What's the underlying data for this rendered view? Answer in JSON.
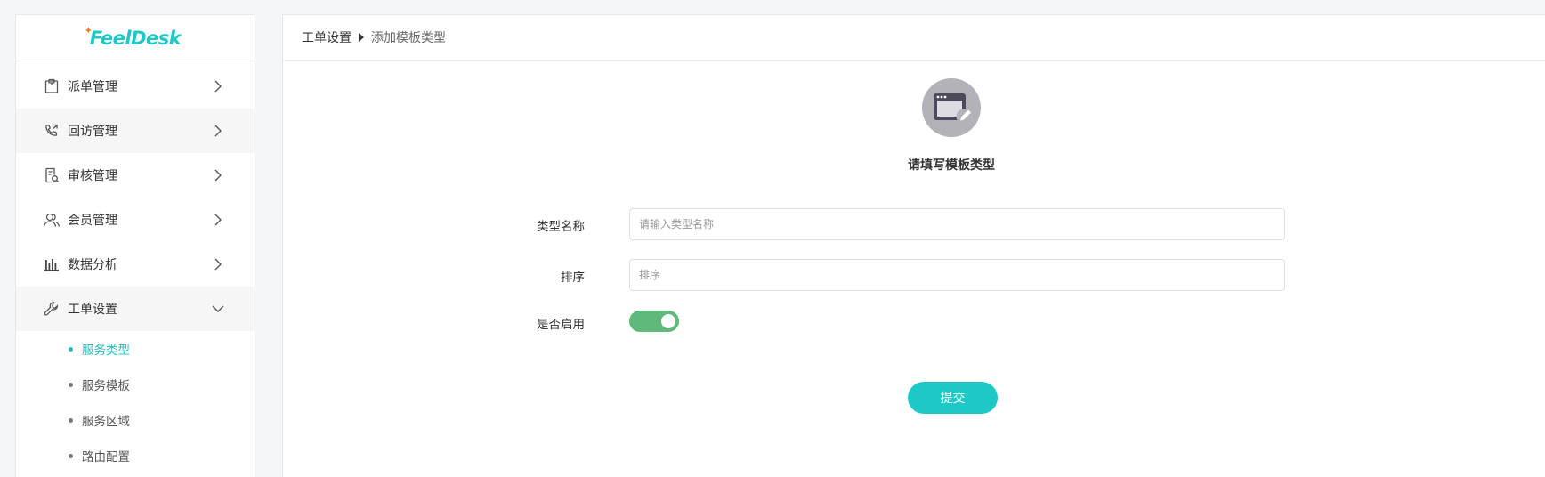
{
  "logo": {
    "text": "FeelDesk",
    "brand_color": "#1fc8c4",
    "accent_color": "#f07a2a"
  },
  "sidebar": {
    "items": [
      {
        "label": "派单管理",
        "icon": "clipboard-icon",
        "expanded": false
      },
      {
        "label": "回访管理",
        "icon": "phone-callback-icon",
        "expanded": false
      },
      {
        "label": "审核管理",
        "icon": "document-search-icon",
        "expanded": false
      },
      {
        "label": "会员管理",
        "icon": "users-icon",
        "expanded": false
      },
      {
        "label": "数据分析",
        "icon": "bar-chart-icon",
        "expanded": false
      },
      {
        "label": "工单设置",
        "icon": "wrench-icon",
        "expanded": true
      }
    ],
    "subitems": [
      {
        "label": "服务类型",
        "active": true
      },
      {
        "label": "服务模板",
        "active": false
      },
      {
        "label": "服务区域",
        "active": false
      },
      {
        "label": "路由配置",
        "active": false
      }
    ],
    "active_color": "#1fbfbd"
  },
  "breadcrumb": {
    "parent": "工单设置",
    "current": "添加模板类型"
  },
  "form": {
    "title": "请填写模板类型",
    "badge_icon": "browser-edit-icon",
    "name_label": "类型名称",
    "name_placeholder": "请输入类型名称",
    "name_value": "",
    "sort_label": "排序",
    "sort_placeholder": "排序",
    "sort_value": "",
    "enable_label": "是否启用",
    "enabled": true,
    "toggle_color": "#5fba7a",
    "submit_label": "提交",
    "submit_color": "#1cc9c6"
  }
}
